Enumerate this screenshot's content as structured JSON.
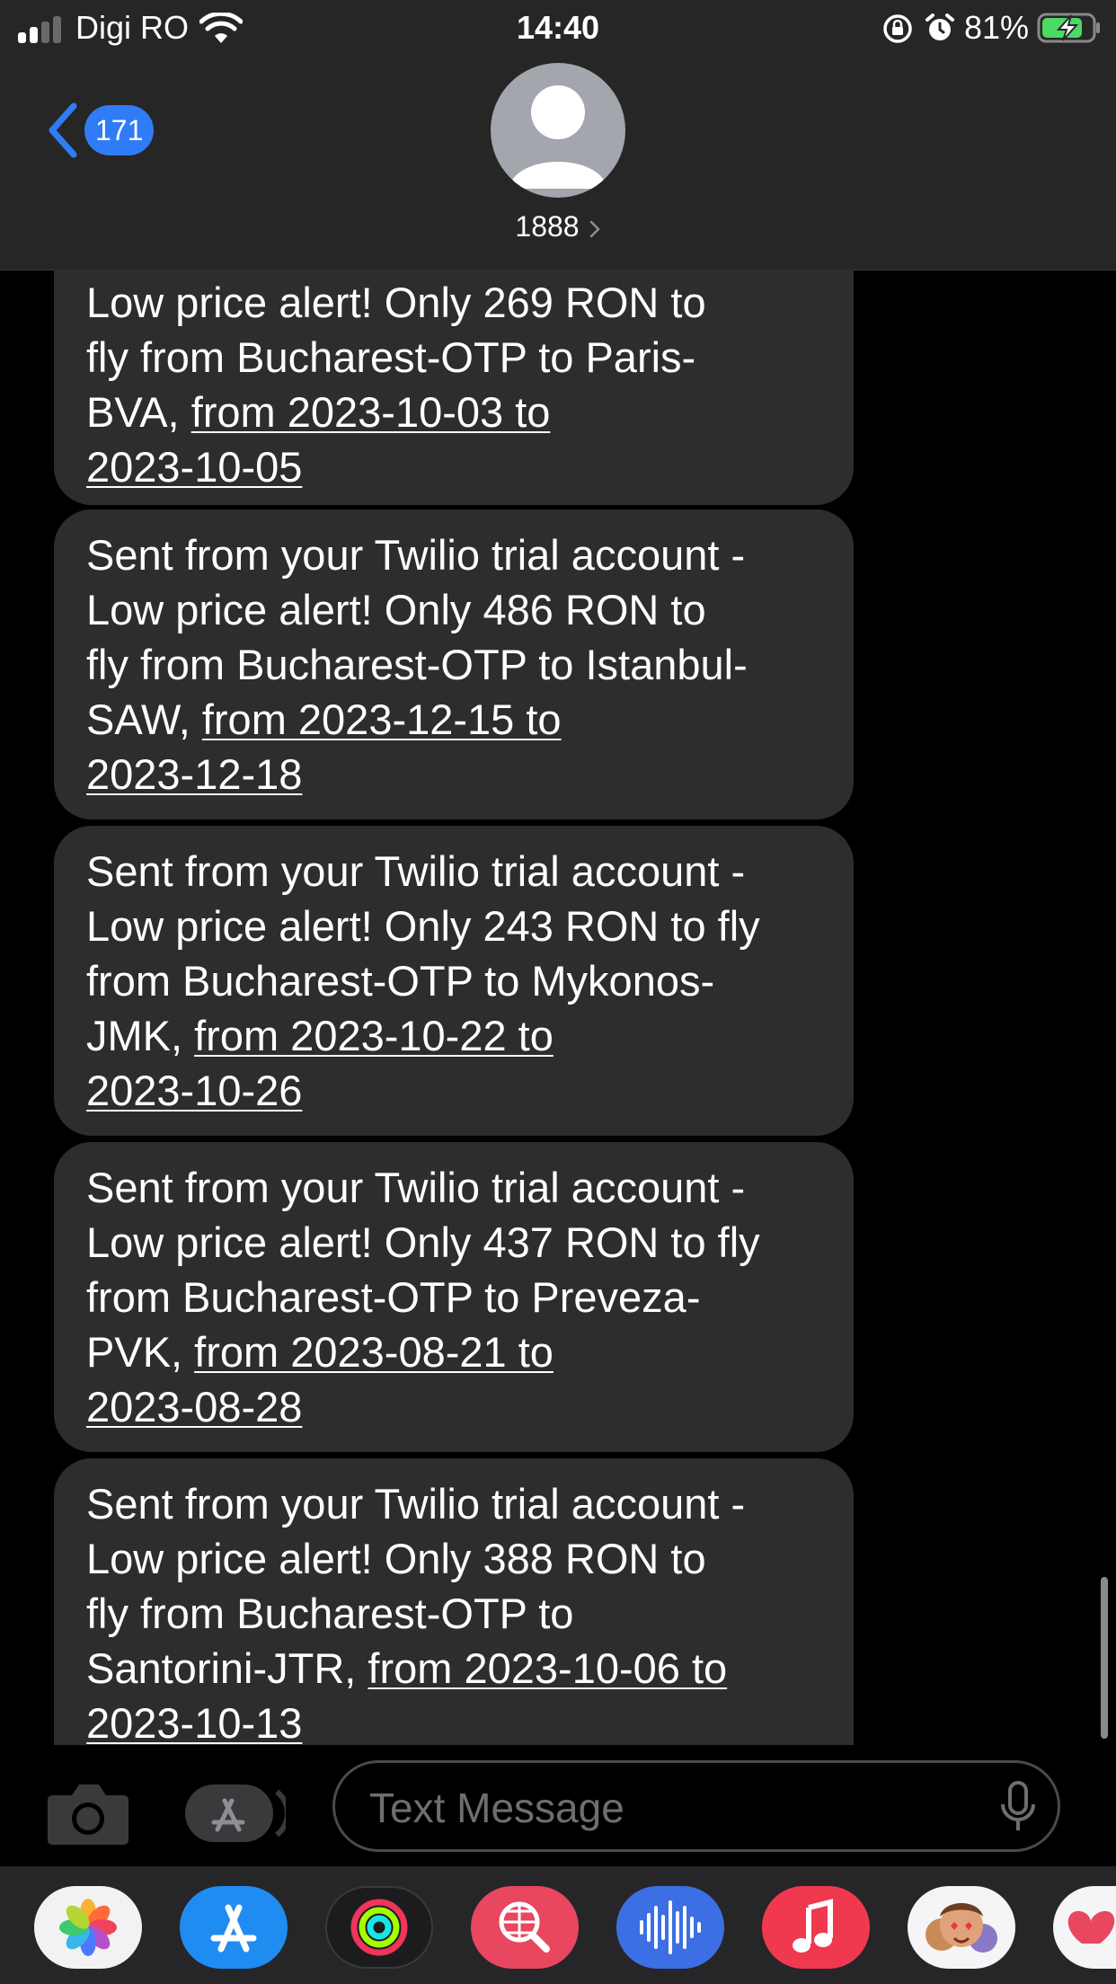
{
  "status_bar": {
    "carrier": "Digi RO",
    "time": "14:40",
    "battery_percent": "81%",
    "battery_level": 0.81,
    "charging": true
  },
  "nav": {
    "back_count": "171",
    "contact_name": "1888"
  },
  "messages": [
    {
      "lines": [
        {
          "text": "Low price alert! Only 269 RON to"
        },
        {
          "text": "fly from Bucharest-OTP to Paris-"
        },
        {
          "text": "BVA, ",
          "link": "from 2023-10-03 to"
        },
        {
          "link": "2023-10-05"
        }
      ]
    },
    {
      "lines": [
        {
          "text": "Sent from your Twilio trial account -"
        },
        {
          "text": "Low price alert! Only 486 RON to"
        },
        {
          "text": "fly from Bucharest-OTP to Istanbul-"
        },
        {
          "text": "SAW, ",
          "link": "from 2023-12-15 to"
        },
        {
          "link": "2023-12-18"
        }
      ]
    },
    {
      "lines": [
        {
          "text": "Sent from your Twilio trial account -"
        },
        {
          "text": "Low price alert! Only 243 RON to fly"
        },
        {
          "text": "from Bucharest-OTP to Mykonos-"
        },
        {
          "text": "JMK, ",
          "link": "from 2023-10-22 to"
        },
        {
          "link": "2023-10-26"
        }
      ]
    },
    {
      "lines": [
        {
          "text": "Sent from your Twilio trial account -"
        },
        {
          "text": "Low price alert! Only 437 RON to fly"
        },
        {
          "text": "from Bucharest-OTP to Preveza-"
        },
        {
          "text": "PVK, ",
          "link": "from 2023-08-21 to"
        },
        {
          "link": "2023-08-28"
        }
      ]
    },
    {
      "lines": [
        {
          "text": "Sent from your Twilio trial account -"
        },
        {
          "text": "Low price alert! Only 388 RON to"
        },
        {
          "text": "fly from Bucharest-OTP to"
        },
        {
          "text": "Santorini-JTR, ",
          "link": "from 2023-10-06 to"
        },
        {
          "link": "2023-10-13"
        }
      ]
    }
  ],
  "input": {
    "placeholder": "Text Message"
  },
  "app_drawer": [
    {
      "name": "Photos",
      "icon": "photos-icon"
    },
    {
      "name": "App Store",
      "icon": "appstore-icon"
    },
    {
      "name": "Fitness",
      "icon": "activity-rings-icon"
    },
    {
      "name": "Search",
      "icon": "globe-search-icon"
    },
    {
      "name": "Audio Messages",
      "icon": "waveform-icon"
    },
    {
      "name": "Music",
      "icon": "music-note-icon"
    },
    {
      "name": "Memoji",
      "icon": "memoji-icon"
    },
    {
      "name": "Digital Touch",
      "icon": "heart-icon"
    }
  ],
  "colors": {
    "accent_blue": "#2f7cf6",
    "bubble_gray": "#2d2d2f",
    "header_bg": "#262626",
    "battery_green": "#4cd964"
  }
}
